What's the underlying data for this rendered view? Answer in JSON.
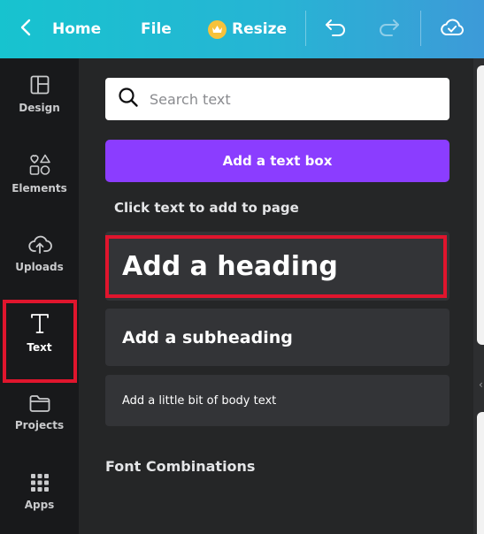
{
  "topbar": {
    "home_label": "Home",
    "file_label": "File",
    "resize_label": "Resize",
    "icons": [
      "chevron-left-icon",
      "crown-icon",
      "undo-icon",
      "redo-icon",
      "cloud-check-icon"
    ]
  },
  "sidebar": {
    "items": [
      {
        "label": "Design",
        "icon": "layout-icon"
      },
      {
        "label": "Elements",
        "icon": "shapes-icon"
      },
      {
        "label": "Uploads",
        "icon": "cloud-upload-icon"
      },
      {
        "label": "Text",
        "icon": "text-icon",
        "active": true
      },
      {
        "label": "Projects",
        "icon": "folder-icon"
      },
      {
        "label": "Apps",
        "icon": "grid-icon"
      }
    ]
  },
  "panel": {
    "search_placeholder": "Search text",
    "add_text_box_label": "Add a text box",
    "hint": "Click text to add to page",
    "heading": "Add a heading",
    "subheading": "Add a subheading",
    "body_text": "Add a little bit of body text",
    "font_combinations": "Font Combinations"
  },
  "colors": {
    "accent_purple": "#8b3dff",
    "highlight_red": "#e0152d",
    "topbar_start": "#17c3cf",
    "topbar_end": "#3d9ad8"
  }
}
